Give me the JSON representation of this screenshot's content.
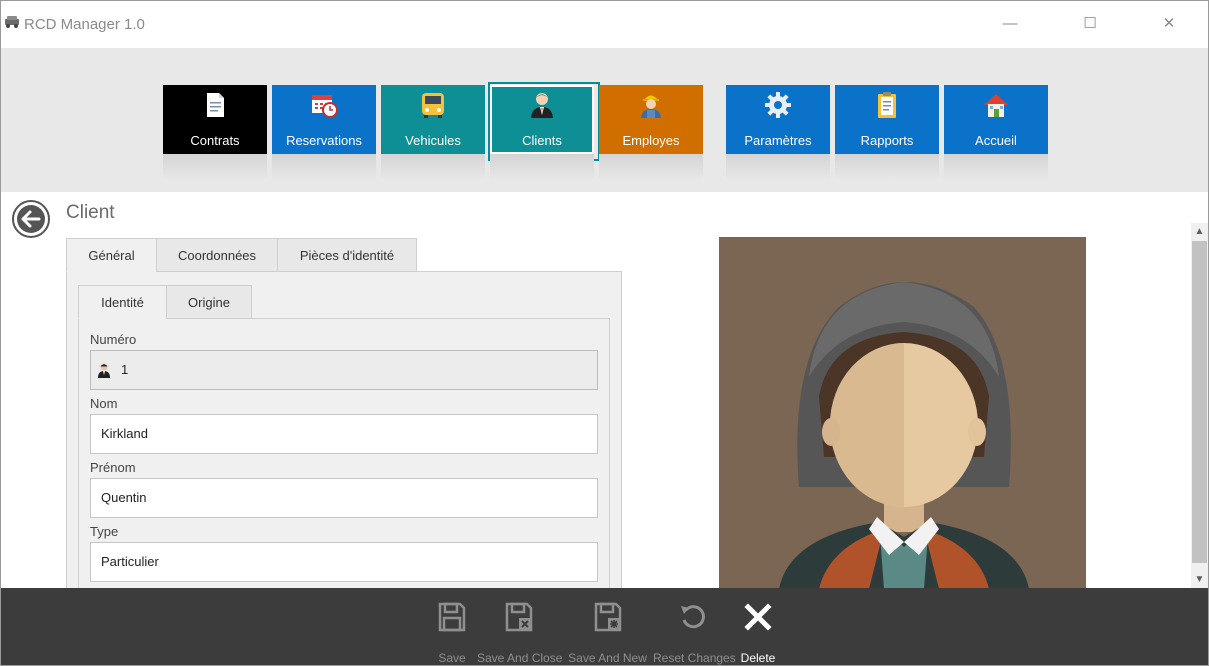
{
  "window": {
    "title": "RCD Manager 1.0",
    "controls": {
      "minimize": "—",
      "maximize": "☐",
      "close": "✕"
    }
  },
  "ribbon": {
    "tiles": [
      {
        "label": "Contrats",
        "icon": "document-icon",
        "color": "#000000"
      },
      {
        "label": "Reservations",
        "icon": "calendar-clock-icon",
        "color": "#0a72c8"
      },
      {
        "label": "Vehicules",
        "icon": "bus-icon",
        "color": "#0e8f96"
      },
      {
        "label": "Clients",
        "icon": "client-person-icon",
        "color": "#0e8f96",
        "selected": true
      },
      {
        "label": "Employes",
        "icon": "worker-icon",
        "color": "#d06f00"
      },
      {
        "label": "Paramètres",
        "icon": "gear-icon",
        "color": "#0a72c8"
      },
      {
        "label": "Rapports",
        "icon": "clipboard-icon",
        "color": "#0a72c8"
      },
      {
        "label": "Accueil",
        "icon": "home-icon",
        "color": "#0a72c8"
      }
    ]
  },
  "page": {
    "title": "Client"
  },
  "tabs": {
    "outer": [
      {
        "label": "Général",
        "active": true
      },
      {
        "label": "Coordonnées",
        "active": false
      },
      {
        "label": "Pièces d'identité",
        "active": false
      }
    ],
    "inner": [
      {
        "label": "Identité",
        "active": true
      },
      {
        "label": "Origine",
        "active": false
      }
    ]
  },
  "form": {
    "numero": {
      "label": "Numéro",
      "value": "1"
    },
    "nom": {
      "label": "Nom",
      "value": "Kirkland"
    },
    "prenom": {
      "label": "Prénom",
      "value": "Quentin"
    },
    "type": {
      "label": "Type",
      "value": "Particulier"
    }
  },
  "scrollbar": {
    "up": "▲",
    "down": "▼"
  },
  "toolbar": {
    "save": "Save",
    "save_close": "Save And Close",
    "save_new": "Save And New",
    "reset": "Reset Changes",
    "delete": "Delete"
  },
  "colors": {
    "ribbon_bg": "#e8e8e8",
    "toolbar_bg": "#3c3c3c",
    "photo_bg": "#7b6553",
    "accent_teal": "#0e8f96"
  }
}
